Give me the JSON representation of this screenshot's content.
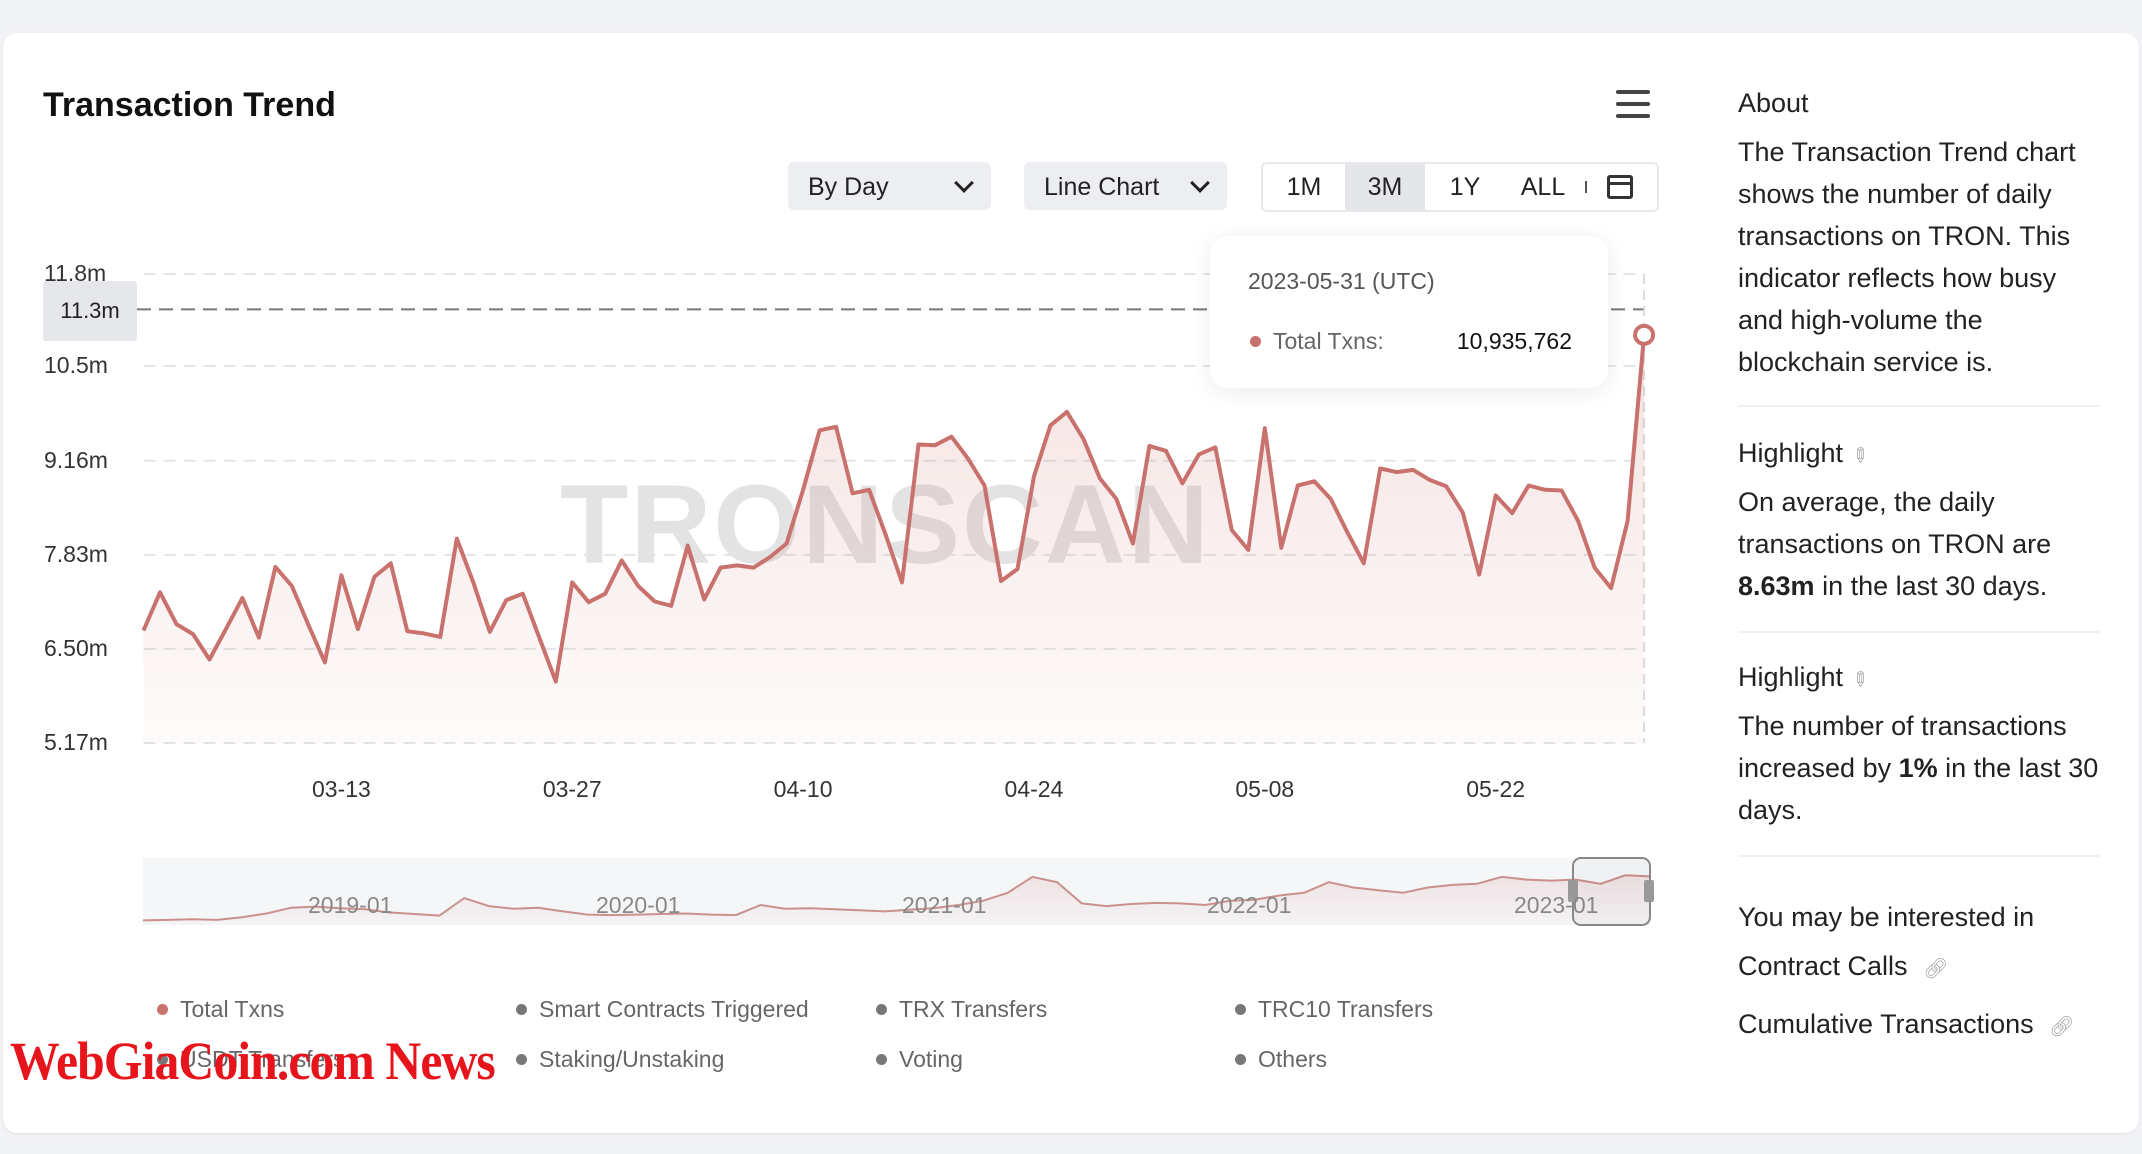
{
  "header": {
    "title": "Transaction Trend",
    "menu_icon": "hamburger-icon"
  },
  "controls": {
    "granularity": "By Day",
    "chart_type": "Line Chart",
    "ranges": [
      "1M",
      "3M",
      "1Y",
      "ALL"
    ],
    "selected_range": "3M",
    "calendar_icon": "calendar-icon"
  },
  "tooltip": {
    "date": "2023-05-31 (UTC)",
    "label": "Total Txns:",
    "value": "10,935,762"
  },
  "crosshair_label": "11.3m",
  "watermark": "TRONSCAN",
  "chart_data": {
    "type": "area",
    "series": [
      {
        "name": "Total Txns",
        "color": "#c9716c"
      }
    ],
    "x": [
      "03-01",
      "03-02",
      "03-03",
      "03-04",
      "03-05",
      "03-06",
      "03-07",
      "03-08",
      "03-09",
      "03-10",
      "03-11",
      "03-12",
      "03-13",
      "03-14",
      "03-15",
      "03-16",
      "03-17",
      "03-18",
      "03-19",
      "03-20",
      "03-21",
      "03-22",
      "03-23",
      "03-24",
      "03-25",
      "03-26",
      "03-27",
      "03-28",
      "03-29",
      "03-30",
      "03-31",
      "04-01",
      "04-02",
      "04-03",
      "04-04",
      "04-05",
      "04-06",
      "04-07",
      "04-08",
      "04-09",
      "04-10",
      "04-11",
      "04-12",
      "04-13",
      "04-14",
      "04-15",
      "04-16",
      "04-17",
      "04-18",
      "04-19",
      "04-20",
      "04-21",
      "04-22",
      "04-23",
      "04-24",
      "04-25",
      "04-26",
      "04-27",
      "04-28",
      "04-29",
      "04-30",
      "05-01",
      "05-02",
      "05-03",
      "05-04",
      "05-05",
      "05-06",
      "05-07",
      "05-08",
      "05-09",
      "05-10",
      "05-11",
      "05-12",
      "05-13",
      "05-14",
      "05-15",
      "05-16",
      "05-17",
      "05-18",
      "05-19",
      "05-20",
      "05-21",
      "05-22",
      "05-23",
      "05-24",
      "05-25",
      "05-26",
      "05-27",
      "05-28",
      "05-29",
      "05-30",
      "05-31"
    ],
    "values": [
      6.76,
      7.3,
      6.85,
      6.71,
      6.35,
      6.78,
      7.22,
      6.66,
      7.66,
      7.39,
      6.84,
      6.31,
      7.54,
      6.78,
      7.52,
      7.71,
      6.75,
      6.72,
      6.67,
      8.06,
      7.44,
      6.74,
      7.19,
      7.28,
      6.66,
      6.04,
      7.44,
      7.16,
      7.28,
      7.75,
      7.39,
      7.17,
      7.11,
      7.96,
      7.2,
      7.65,
      7.68,
      7.65,
      7.8,
      7.99,
      8.75,
      9.59,
      9.64,
      8.7,
      8.75,
      8.12,
      7.44,
      9.39,
      9.38,
      9.5,
      9.19,
      8.81,
      7.46,
      7.63,
      8.94,
      9.66,
      9.85,
      9.47,
      8.91,
      8.62,
      7.99,
      9.37,
      9.3,
      8.84,
      9.25,
      9.35,
      8.18,
      7.9,
      9.62,
      7.93,
      8.81,
      8.87,
      8.62,
      8.15,
      7.71,
      9.05,
      9.0,
      9.03,
      8.89,
      8.8,
      8.43,
      7.55,
      8.67,
      8.42,
      8.81,
      8.75,
      8.74,
      8.31,
      7.65,
      7.36,
      8.31,
      10.94
    ],
    "value_unit": "m",
    "highlighted_point": {
      "x": "05-31",
      "value": 10.94
    },
    "crosshair_value": 11.3,
    "ylim": [
      5.17,
      11.8
    ],
    "yticks": [
      "11.8m",
      "10.5m",
      "9.16m",
      "7.83m",
      "6.50m",
      "5.17m"
    ],
    "ytick_values": [
      11.8,
      10.5,
      9.16,
      7.83,
      6.5,
      5.17
    ],
    "xticks": [
      "03-13",
      "03-27",
      "04-10",
      "04-24",
      "05-08",
      "05-22"
    ],
    "grid": true,
    "legend": {
      "position": "bottom",
      "items": [
        {
          "label": "Total Txns",
          "color": "#c9716c"
        },
        {
          "label": "Smart Contracts Triggered",
          "color": "#777777"
        },
        {
          "label": "TRX Transfers",
          "color": "#777777"
        },
        {
          "label": "TRC10 Transfers",
          "color": "#777777"
        },
        {
          "label": "USDT Transfers",
          "color": "#777777"
        },
        {
          "label": "Staking/Unstaking",
          "color": "#777777"
        },
        {
          "label": "Voting",
          "color": "#777777"
        },
        {
          "label": "Others",
          "color": "#777777"
        }
      ]
    },
    "navigator": {
      "xticks": [
        "2019-01",
        "2020-01",
        "2021-01",
        "2022-01",
        "2023-01"
      ],
      "monthly_values_approx": [
        0.3,
        0.4,
        0.5,
        0.4,
        0.9,
        1.6,
        2.7,
        2.9,
        2.6,
        2.4,
        1.8,
        1.5,
        1.2,
        4.5,
        3.0,
        2.5,
        2.7,
        2.0,
        1.4,
        1.3,
        1.4,
        1.5,
        1.6,
        1.4,
        1.3,
        3.2,
        2.5,
        2.6,
        2.4,
        2.2,
        2.0,
        2.3,
        2.6,
        3.2,
        4.0,
        5.5,
        8.5,
        7.5,
        3.5,
        3.0,
        3.4,
        3.6,
        3.5,
        3.2,
        4.0,
        4.2,
        5.0,
        5.5,
        7.5,
        6.5,
        6.0,
        5.5,
        6.5,
        7.0,
        7.2,
        8.5,
        8.0,
        7.8,
        8.0,
        7.2,
        8.8,
        8.6
      ]
    }
  },
  "sidebar": {
    "about_label": "About",
    "about_text": "The Transaction Trend chart shows the number of daily transactions on TRON. This indicator reflects how busy and high-volume the blockchain service is.",
    "highlight1": {
      "label": "Highlight",
      "before": "On average, the daily transactions on TRON are ",
      "bold": "8.63m",
      "after": " in the last 30 days."
    },
    "highlight2": {
      "label": "Highlight",
      "before": "The number of transactions increased by ",
      "bold": "1%",
      "after": " in the last 30 days."
    },
    "related_label": "You may be interested in",
    "links": [
      "Contract Calls",
      "Cumulative Transactions"
    ]
  },
  "overlay_watermark": "WebGiaCoin.com News"
}
